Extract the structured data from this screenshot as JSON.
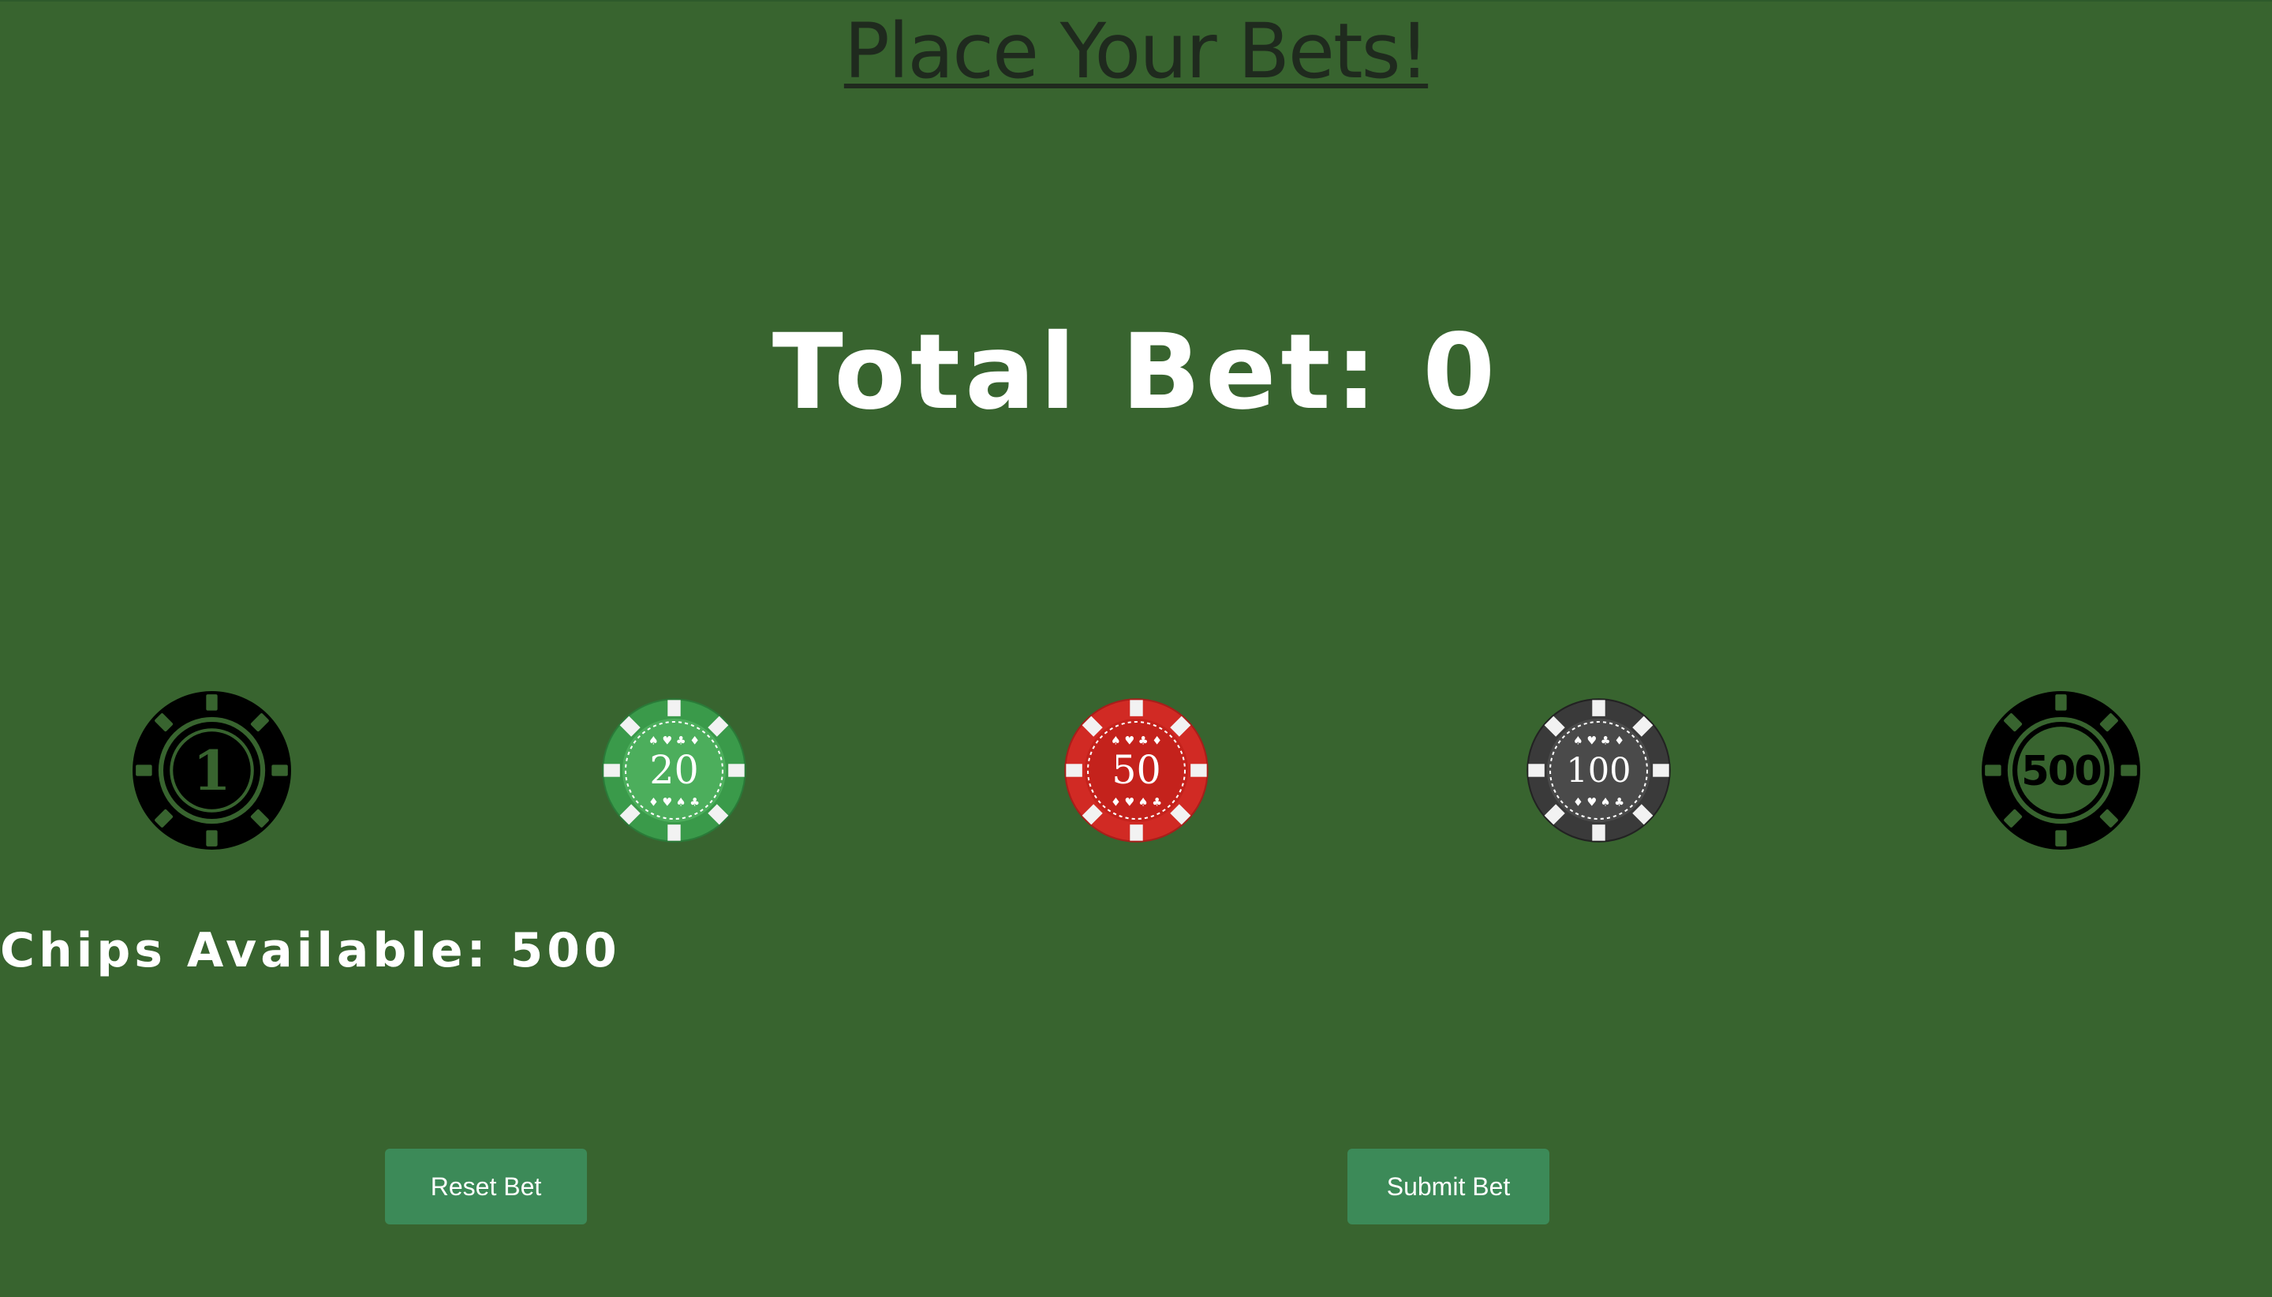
{
  "page": {
    "title": "Place Your Bets!"
  },
  "bet": {
    "total_label": "Total Bet: 0"
  },
  "chips": {
    "available_label": "Chips Available: 500",
    "items": [
      {
        "value": "1",
        "color": "#000000",
        "icon": "chip-1-icon"
      },
      {
        "value": "20",
        "color": "#3a9a4a",
        "icon": "chip-20-icon"
      },
      {
        "value": "50",
        "color": "#d12a24",
        "icon": "chip-50-icon"
      },
      {
        "value": "100",
        "color": "#3a3a3a",
        "icon": "chip-100-icon"
      },
      {
        "value": "500",
        "color": "#000000",
        "icon": "chip-500-icon"
      }
    ]
  },
  "buttons": {
    "reset_label": "Reset Bet",
    "submit_label": "Submit Bet"
  },
  "colors": {
    "table_felt": "#38642f",
    "button": "#3c8a58",
    "title_text": "#1f2a1e"
  }
}
